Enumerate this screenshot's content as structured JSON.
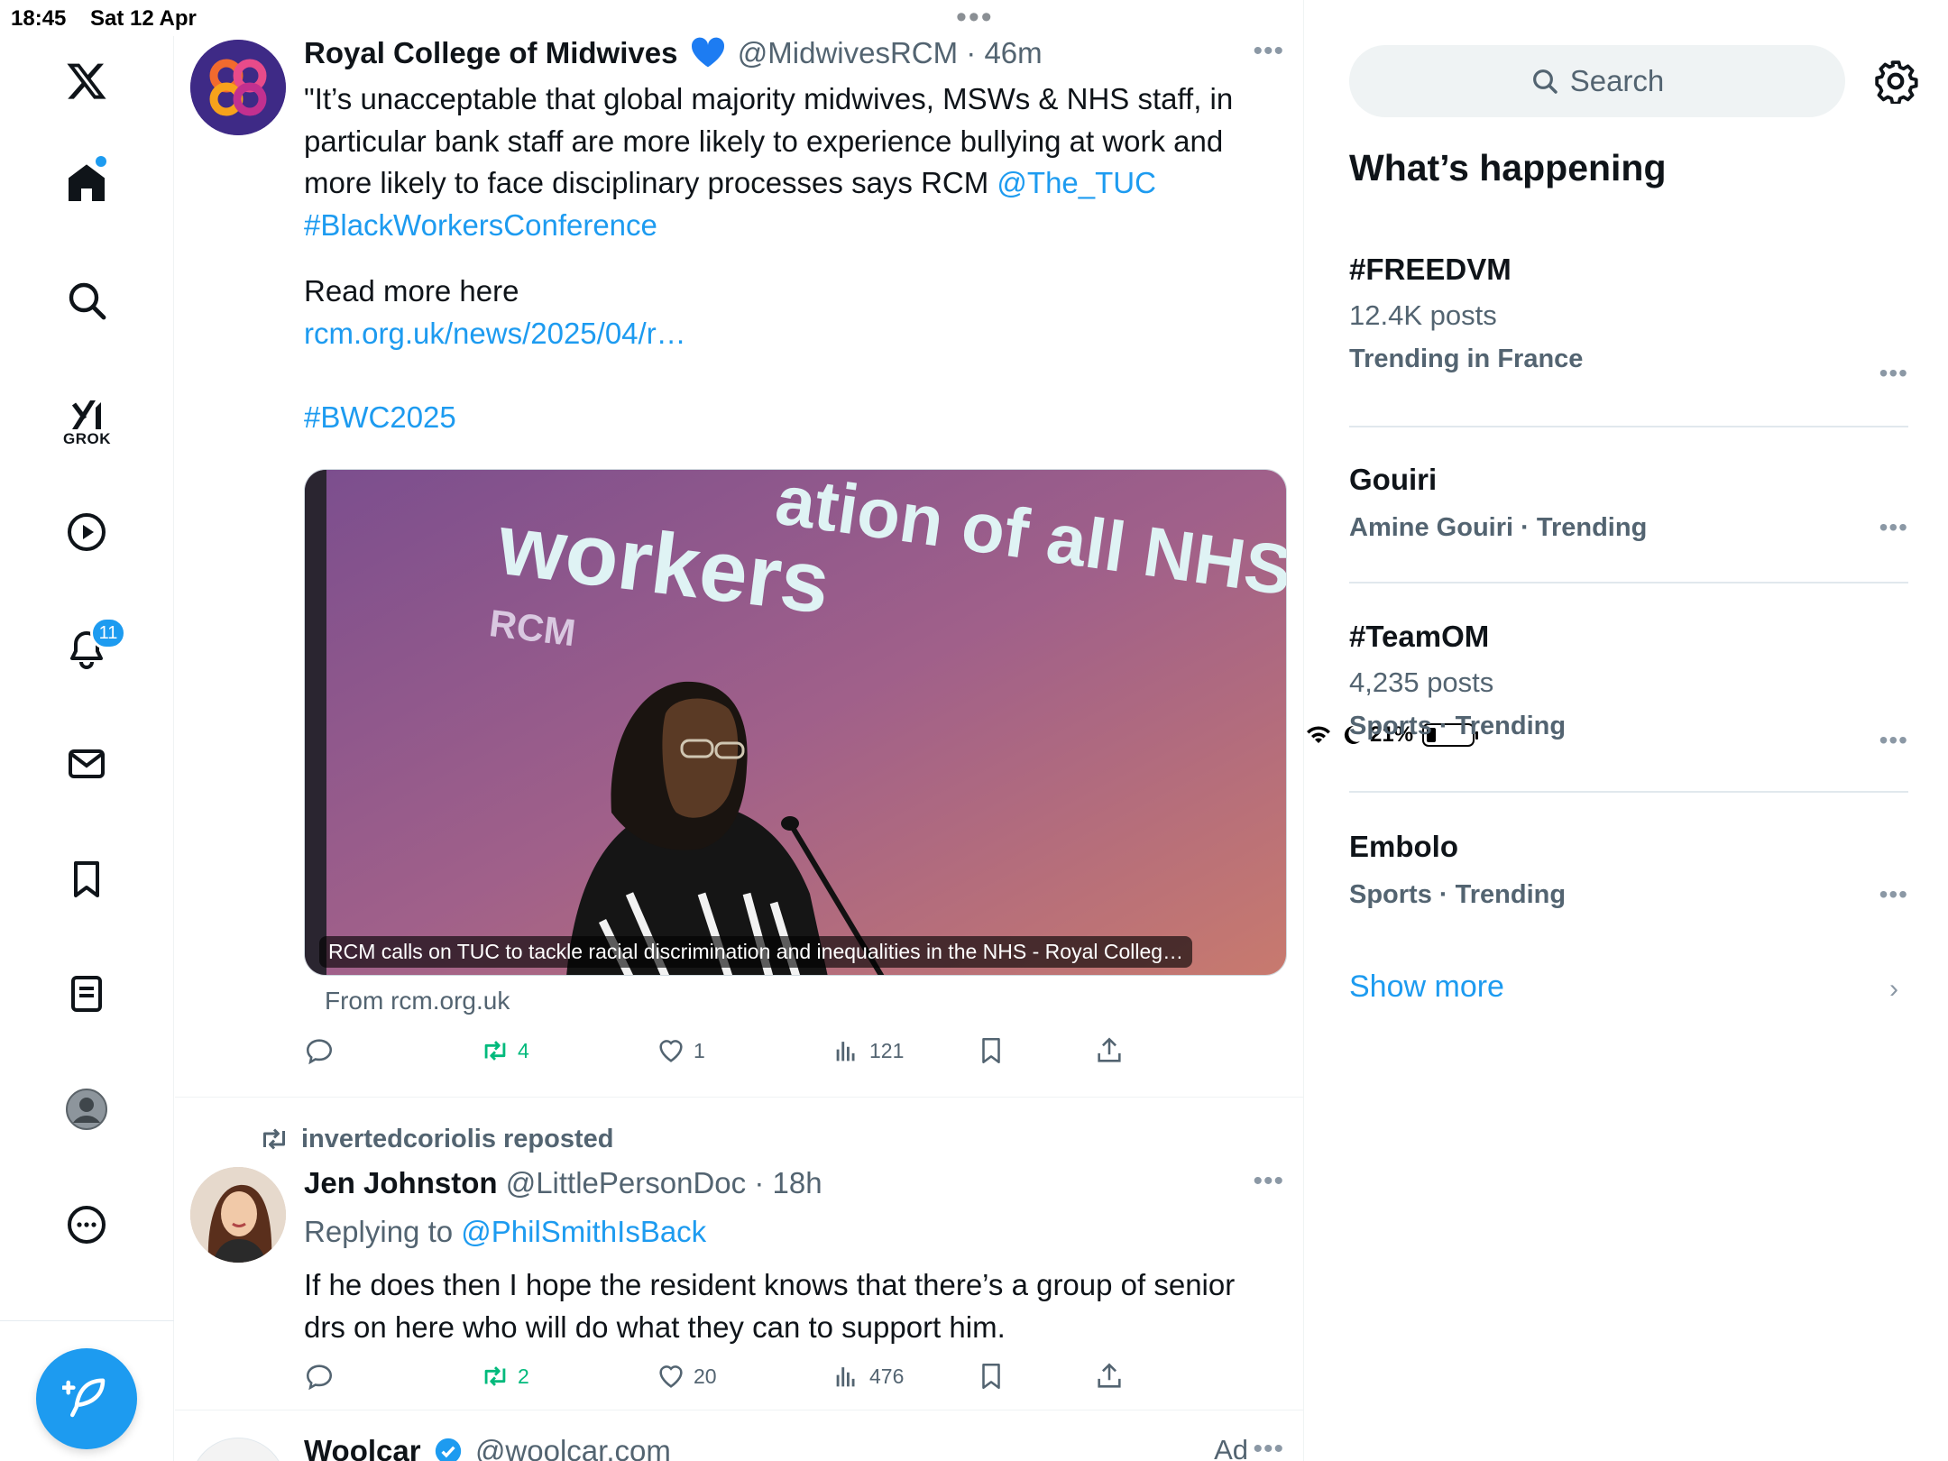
{
  "status_bar": {
    "time": "18:45",
    "date": "Sat 12 Apr",
    "battery": "21%"
  },
  "nav": {
    "items": [
      {
        "name": "x-logo-icon"
      },
      {
        "name": "home-icon"
      },
      {
        "name": "search-icon"
      },
      {
        "name": "grok-icon",
        "label": "GROK"
      },
      {
        "name": "video-icon"
      },
      {
        "name": "notifications-icon",
        "badge": "11"
      },
      {
        "name": "messages-icon"
      },
      {
        "name": "bookmarks-icon"
      },
      {
        "name": "lists-icon"
      },
      {
        "name": "profile-icon"
      },
      {
        "name": "more-icon"
      }
    ],
    "compose_label": "Post"
  },
  "feed": {
    "tweets": [
      {
        "author": "Royal College of Midwives",
        "handle": "@MidwivesRCM",
        "time": "· 46m",
        "text_line1": "\"It’s unacceptable that global majority midwives, MSWs & NHS staff, in",
        "text_line2": "particular bank  staff are more likely to experience bullying at work and",
        "text_line3": "more likely to face disciplinary processes says RCM ",
        "mention": "@The_TUC",
        "hashtag1": "#BlackWorkersConference",
        "read_more": "Read more here",
        "url": "rcm.org.uk/news/2025/04/r…",
        "hashtag2": "#BWC2025",
        "card_image_text_top": "ation of all NHS",
        "card_image_text_workers": "workers",
        "card_image_text_rcm": "RCM",
        "card_caption": "RCM calls on TUC to tackle racial discrimination and inequalities in the NHS - Royal Colleg…",
        "card_from": "From rcm.org.uk",
        "retweets": "4",
        "likes": "1",
        "views": "121"
      },
      {
        "repost_by": "invertedcoriolis reposted",
        "author": "Jen Johnston",
        "handle": "@LittlePersonDoc",
        "time": "· 18h",
        "replying_label": "Replying to ",
        "replying_to": "@PhilSmithIsBack",
        "text_line1": "If he does then I hope the resident knows that there’s a group of senior",
        "text_line2": "drs on here who will do what they can to support him.",
        "retweets": "2",
        "likes": "20",
        "views": "476"
      },
      {
        "author": "Woolcar",
        "handle": "@woolcar.com",
        "ad_label": "Ad"
      }
    ]
  },
  "sidebar": {
    "search_placeholder": "Search",
    "heading": "What’s happening",
    "trends": [
      {
        "name": "#FREEDVM",
        "posts": "12.4K posts",
        "context": "Trending in France"
      },
      {
        "name": "Gouiri",
        "posts": "",
        "context": "Amine Gouiri · Trending"
      },
      {
        "name": "#TeamOM",
        "posts": "4,235 posts",
        "context": "Sports · Trending"
      },
      {
        "name": "Embolo",
        "posts": "",
        "context": "Sports · Trending"
      }
    ],
    "show_more": "Show more"
  },
  "colors": {
    "accent": "#1d9bf0",
    "retweet_green": "#00ba7c",
    "muted": "#536471"
  }
}
